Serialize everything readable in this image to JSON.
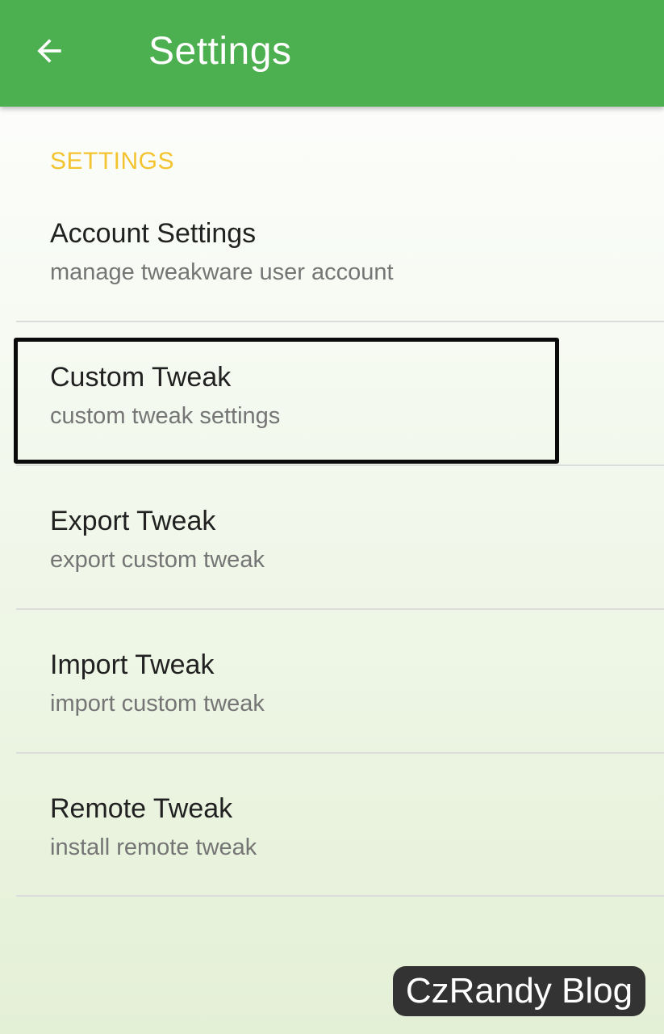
{
  "app_bar": {
    "title": "Settings",
    "background_color": "#4caf50",
    "back_icon": "arrow-back-icon"
  },
  "section": {
    "header": "SETTINGS",
    "header_color": "#f4c430"
  },
  "preferences": [
    {
      "title": "Account Settings",
      "summary": "manage tweakware user account"
    },
    {
      "title": "Custom Tweak",
      "summary": "custom tweak settings",
      "highlighted": true
    },
    {
      "title": "Export Tweak",
      "summary": "export custom tweak"
    },
    {
      "title": "Import Tweak",
      "summary": "import custom tweak"
    },
    {
      "title": "Remote Tweak",
      "summary": "install remote tweak"
    }
  ],
  "watermark": {
    "text": "CzRandy Blog"
  }
}
